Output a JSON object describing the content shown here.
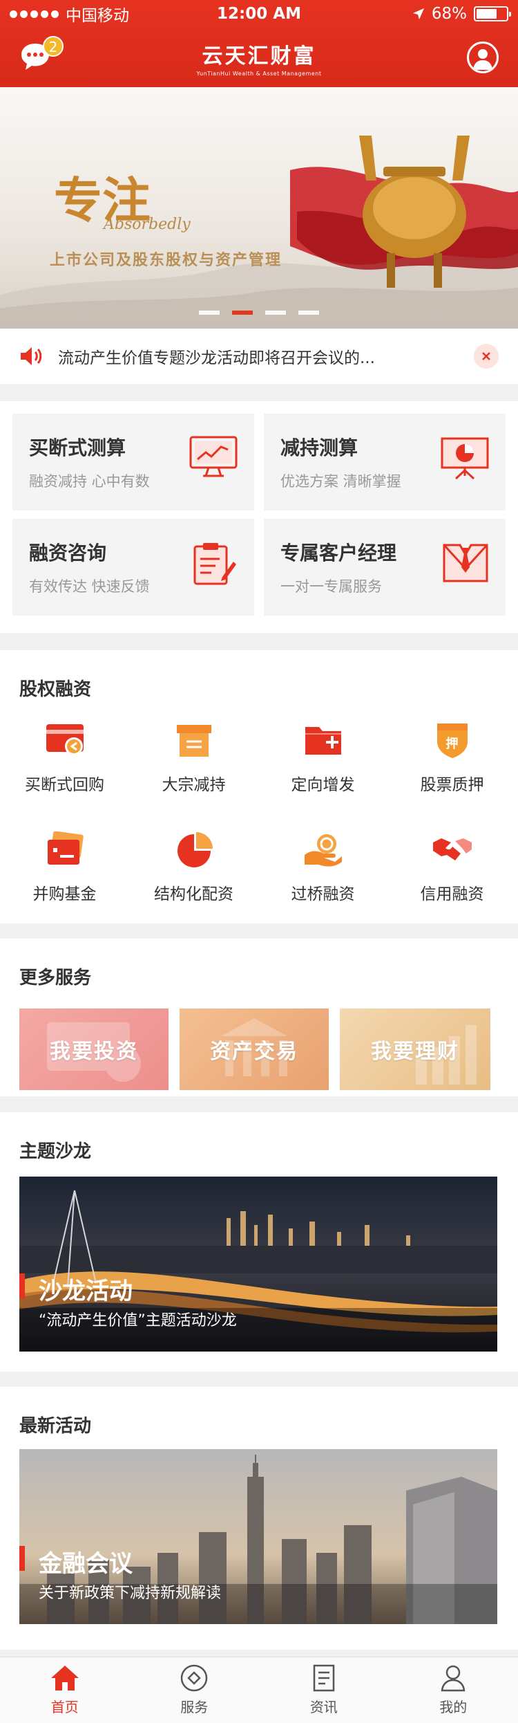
{
  "status_bar": {
    "carrier": "中国移动",
    "time": "12:00 AM",
    "battery": "68%",
    "battery_level": 0.68
  },
  "header": {
    "brand": "云天汇财富",
    "brand_sub": "YunTianHui Wealth & Asset Management",
    "message_badge": "2"
  },
  "banner": {
    "title": "专注",
    "title_en": "Absorbedly",
    "subtitle": "上市公司及股东股权与资产管理",
    "slide_count": 4,
    "active_slide": 2
  },
  "notice": {
    "text": "流动产生价值专题沙龙活动即将召开会议的..."
  },
  "tools": [
    {
      "title": "买断式测算",
      "desc": "融资减持 心中有数",
      "icon": "rising-chart-screen-icon"
    },
    {
      "title": "减持测算",
      "desc": "优选方案 清晰掌握",
      "icon": "pie-chart-board-icon"
    },
    {
      "title": "融资咨询",
      "desc": "有效传达 快速反馈",
      "icon": "clipboard-pen-icon"
    },
    {
      "title": "专属客户经理",
      "desc": "一对一专属服务",
      "icon": "manager-tie-icon"
    }
  ],
  "equity": {
    "title": "股权融资",
    "items": [
      {
        "label": "买断式回购",
        "icon": "card-return-icon"
      },
      {
        "label": "大宗减持",
        "icon": "box-icon"
      },
      {
        "label": "定向增发",
        "icon": "folder-plus-icon"
      },
      {
        "label": "股票质押",
        "icon": "shield-pledge-icon",
        "glyph": "押"
      },
      {
        "label": "并购基金",
        "icon": "cards-icon"
      },
      {
        "label": "结构化配资",
        "icon": "pie-icon"
      },
      {
        "label": "过桥融资",
        "icon": "coin-hand-icon"
      },
      {
        "label": "信用融资",
        "icon": "handshake-icon"
      }
    ]
  },
  "more": {
    "title": "更多服务",
    "cards": [
      {
        "label": "我要投资"
      },
      {
        "label": "资产交易"
      },
      {
        "label": "我要理财"
      }
    ]
  },
  "salon": {
    "title": "主题沙龙",
    "feature": {
      "title": "沙龙活动",
      "subtitle": "“流动产生价值”主题活动沙龙"
    }
  },
  "activity": {
    "title": "最新活动",
    "feature": {
      "title": "金融会议",
      "subtitle": "关于新政策下减持新规解读"
    }
  },
  "tabbar": [
    {
      "label": "首页",
      "active": true
    },
    {
      "label": "服务",
      "active": false
    },
    {
      "label": "资讯",
      "active": false
    },
    {
      "label": "我的",
      "active": false
    }
  ],
  "colors": {
    "brand_red": "#e63221",
    "tab_active": "#e63221",
    "badge": "#f5b82a"
  }
}
